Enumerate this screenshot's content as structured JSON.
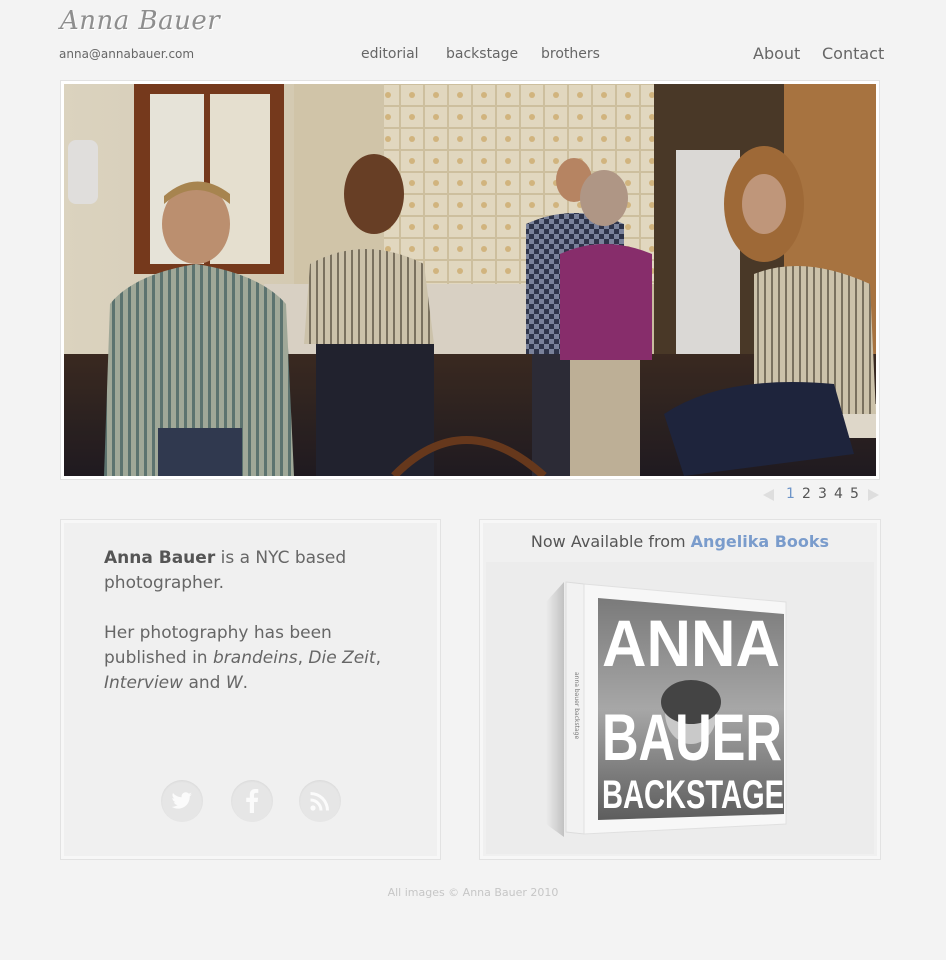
{
  "header": {
    "logo": "Anna Bauer",
    "email": "anna@annabauer.com",
    "nav": [
      "editorial",
      "backstage",
      "brothers"
    ],
    "about": "About",
    "contact": "Contact"
  },
  "pager": {
    "pages": [
      "1",
      "2",
      "3",
      "4",
      "5"
    ],
    "active": "1"
  },
  "bio": {
    "name": "Anna Bauer",
    "line1_rest": " is a NYC based photographer.",
    "p2_start": "Her photography has been published in ",
    "pub1": "brandeins",
    "sep1": ", ",
    "pub2": "Die Zeit",
    "sep2": ", ",
    "pub3": "Interview",
    "sep3": " and ",
    "pub4": "W",
    "end": "."
  },
  "social": {
    "twitter": "twitter-icon",
    "facebook": "facebook-icon",
    "rss": "rss-icon"
  },
  "book": {
    "prefix": "Now Available from ",
    "link": "Angelika Books",
    "cover_line1": "ANNA",
    "cover_line2": "BAUER",
    "cover_line3": "BACKSTAGE",
    "spine": "anna bauer backstage"
  },
  "footer": "All images © Anna Bauer 2010",
  "colors": {
    "accent": "#6d94c8",
    "background": "#f3f3f3"
  }
}
